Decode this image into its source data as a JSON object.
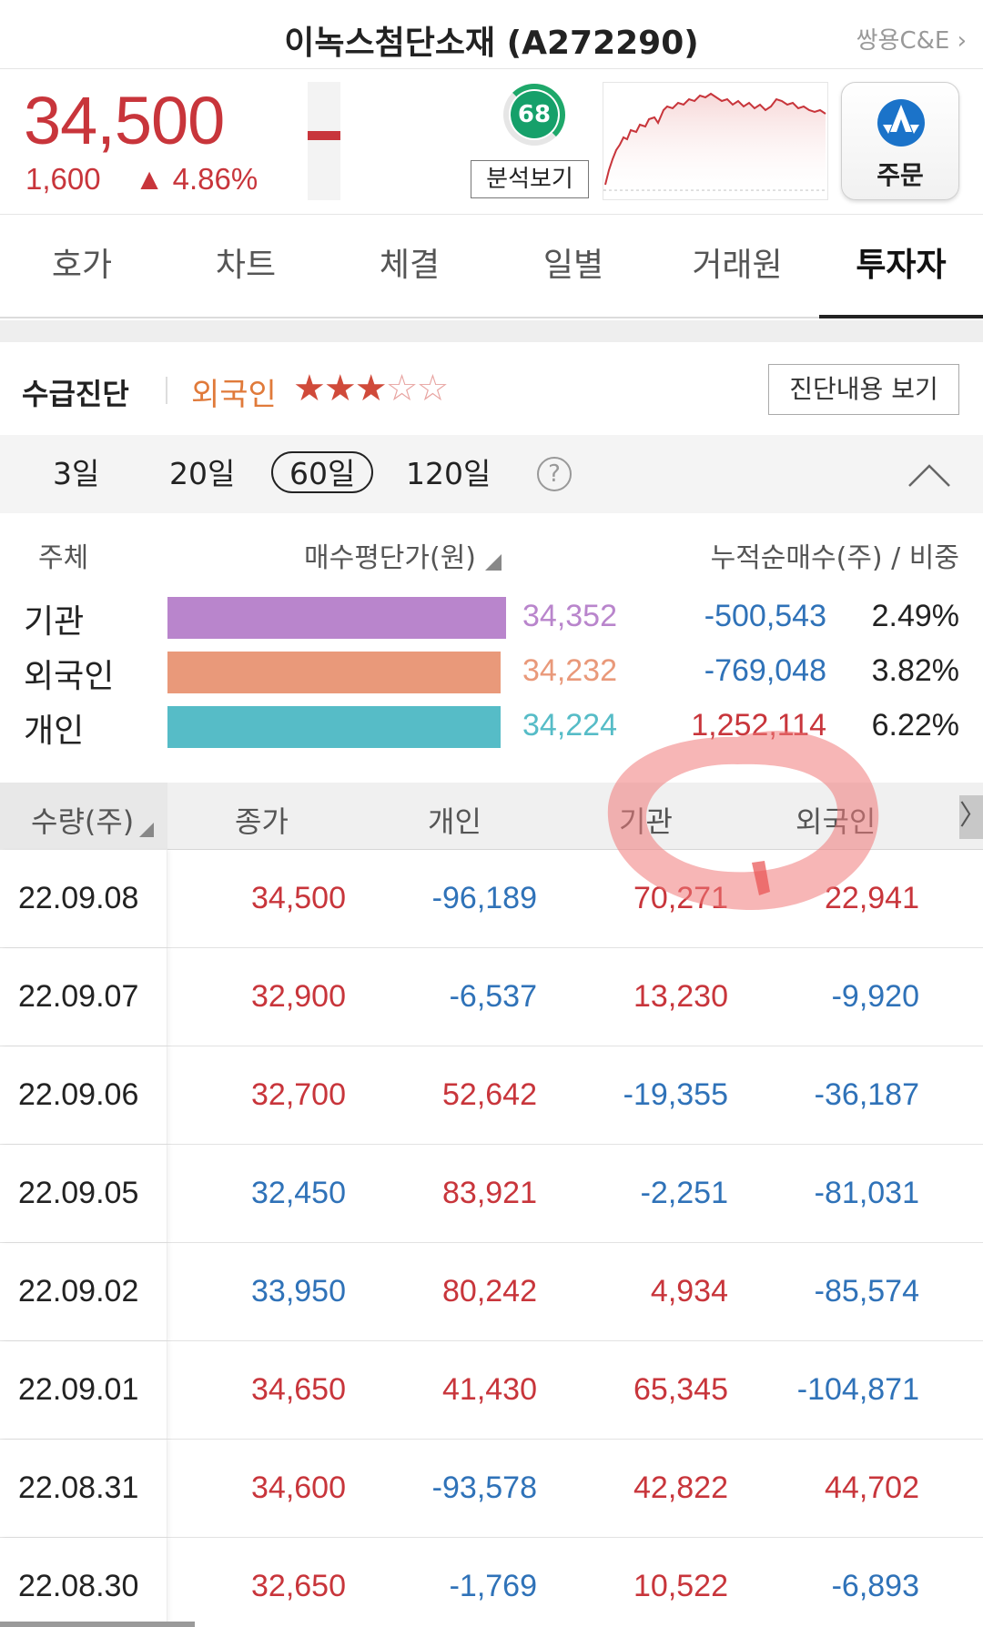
{
  "header": {
    "title": "이녹스첨단소재 (A272290)",
    "related": "쌍용C&E"
  },
  "quote": {
    "price": "34,500",
    "change": "1,600",
    "change_rate": "4.86%",
    "score": "68",
    "analysis_label": "분석보기",
    "order_label": "주문"
  },
  "tabs": [
    {
      "label": "호가"
    },
    {
      "label": "차트"
    },
    {
      "label": "체결"
    },
    {
      "label": "일별"
    },
    {
      "label": "거래원"
    },
    {
      "label": "투자자"
    }
  ],
  "diagnosis": {
    "title": "수급진단",
    "investor": "외국인",
    "stars_on": "★★★",
    "stars_off": "☆☆",
    "rating": 3,
    "view_button": "진단내용 보기"
  },
  "periods": [
    {
      "label": "3일"
    },
    {
      "label": "20일"
    },
    {
      "label": "60일"
    },
    {
      "label": "120일"
    }
  ],
  "help_icon": "?",
  "avg_price": {
    "headers": {
      "subject": "주체",
      "price": "매수평단가(원)",
      "net": "누적순매수(주) / 비중"
    },
    "rows": [
      {
        "name": "기관",
        "price": "34,352",
        "net": "-500,543",
        "ratio": "2.49%",
        "bar_fraction": 1.0,
        "color": "#b985cc"
      },
      {
        "name": "외국인",
        "price": "34,232",
        "net": "-769,048",
        "ratio": "3.82%",
        "bar_fraction": 0.985,
        "color": "#e9997a"
      },
      {
        "name": "개인",
        "price": "34,224",
        "net": "1,252,114",
        "ratio": "6.22%",
        "bar_fraction": 0.985,
        "color": "#56bcc7"
      }
    ]
  },
  "table": {
    "headers": {
      "volume": "수량(주)",
      "close": "종가",
      "individual": "개인",
      "institution": "기관",
      "foreign": "외국인"
    },
    "more_icon": "〉",
    "rows": [
      {
        "date": "22.09.08",
        "close": "34,500",
        "individual": "-96,189",
        "institution": "70,271",
        "foreign": "22,941"
      },
      {
        "date": "22.09.07",
        "close": "32,900",
        "individual": "-6,537",
        "institution": "13,230",
        "foreign": "-9,920"
      },
      {
        "date": "22.09.06",
        "close": "32,700",
        "individual": "52,642",
        "institution": "-19,355",
        "foreign": "-36,187"
      },
      {
        "date": "22.09.05",
        "close": "32,450",
        "individual": "83,921",
        "institution": "-2,251",
        "foreign": "-81,031"
      },
      {
        "date": "22.09.02",
        "close": "33,950",
        "individual": "80,242",
        "institution": "4,934",
        "foreign": "-85,574"
      },
      {
        "date": "22.09.01",
        "close": "34,650",
        "individual": "41,430",
        "institution": "65,345",
        "foreign": "-104,871"
      },
      {
        "date": "22.08.31",
        "close": "34,600",
        "individual": "-93,578",
        "institution": "42,822",
        "foreign": "44,702"
      },
      {
        "date": "22.08.30",
        "close": "32,650",
        "individual": "-1,769",
        "institution": "10,522",
        "foreign": "-6,893"
      }
    ]
  },
  "colors": {
    "up": "#c8353b",
    "down": "#2f72b8",
    "accent_green": "#16a06a",
    "annotation": "#f07a7a"
  }
}
